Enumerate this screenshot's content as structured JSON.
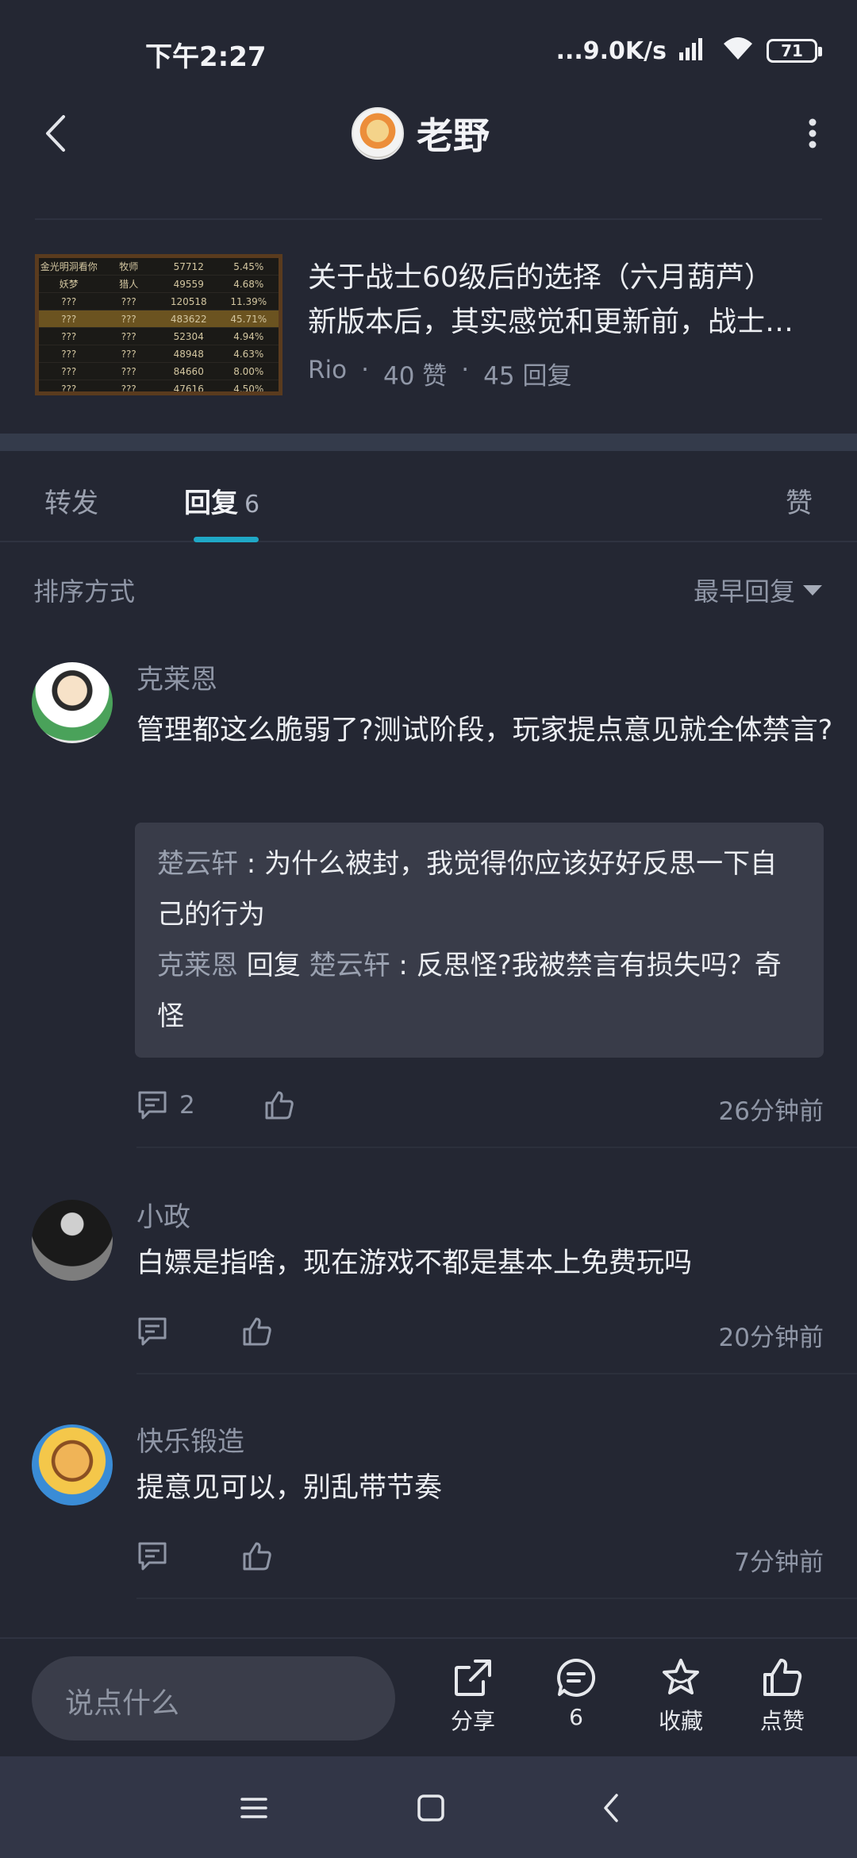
{
  "status_bar": {
    "time": "下午2:27",
    "net_speed": "...9.0K/s",
    "battery": "71"
  },
  "header": {
    "title": "老野"
  },
  "post": {
    "title_line1": "关于战士60级后的选择（六月葫芦）",
    "title_line2": "新版本后，其实感觉和更新前，战士…",
    "author": "Rio",
    "separator": "·",
    "likes": "40 赞",
    "replies": "45 回复",
    "thumb_rows": [
      [
        "金光明洞看你",
        "牧师",
        "57712",
        "5.45%"
      ],
      [
        "妖梦",
        "猎人",
        "49559",
        "4.68%"
      ],
      [
        "???",
        "???",
        "120518",
        "11.39%"
      ],
      [
        "???",
        "???",
        "483622",
        "45.71%"
      ],
      [
        "???",
        "???",
        "52304",
        "4.94%"
      ],
      [
        "???",
        "???",
        "48948",
        "4.63%"
      ],
      [
        "???",
        "???",
        "84660",
        "8.00%"
      ],
      [
        "???",
        "???",
        "47616",
        "4.50%"
      ]
    ]
  },
  "tabs": {
    "forward": "转发",
    "reply": "回复",
    "reply_count": "6",
    "like": "赞"
  },
  "sort": {
    "label": "排序方式",
    "value": "最早回复"
  },
  "comments": [
    {
      "name": "克莱恩",
      "text": "管理都这么脆弱了?测试阶段，玩家提点意见就全体禁言?",
      "sub_replies": [
        {
          "user": "楚云轩",
          "text": " : 为什么被封，我觉得你应该好好反思一下自己的行为"
        },
        {
          "user": "克莱恩",
          "reply_word": " 回复 ",
          "target": "楚云轩",
          "text": " : 反思怪?我被禁言有损失吗？奇怪"
        }
      ],
      "reply_count": "2",
      "time": "26分钟前"
    },
    {
      "name": "小政",
      "text": "白嫖是指啥，现在游戏不都是基本上免费玩吗",
      "time": "20分钟前"
    },
    {
      "name": "快乐锻造",
      "text": "提意见可以，别乱带节奏",
      "time": "7分钟前"
    }
  ],
  "bottom_bar": {
    "input_placeholder": "说点什么",
    "share": "分享",
    "comments": "6",
    "favorite": "收藏",
    "like": "点赞"
  },
  "icons": {
    "back": "chevron-left-icon",
    "more": "more-vertical-icon",
    "reply": "comment-icon",
    "like": "thumb-up-icon",
    "share": "share-icon",
    "favorite": "star-icon"
  }
}
